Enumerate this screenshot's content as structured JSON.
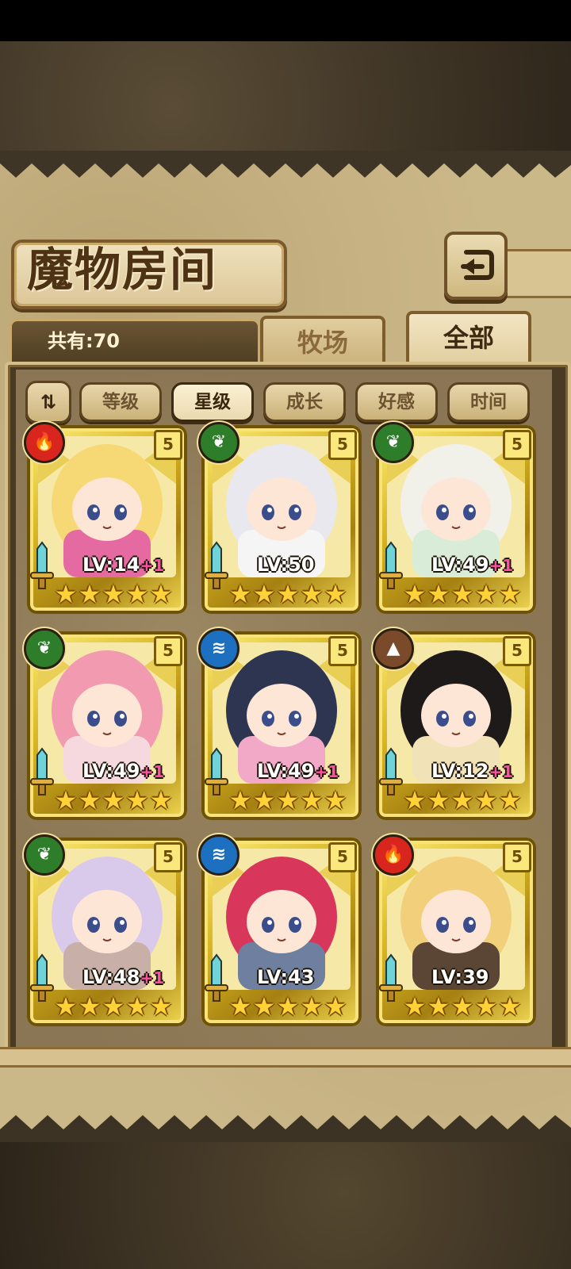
{
  "header": {
    "title": "魔物房间"
  },
  "tabs": [
    {
      "label": "牧场",
      "active": false
    },
    {
      "label": "全部",
      "active": true
    }
  ],
  "summary": {
    "count_label": "共有:70"
  },
  "sort": {
    "toggle_label": "⇅",
    "options": [
      {
        "label": "等级",
        "active": false
      },
      {
        "label": "星级",
        "active": true
      },
      {
        "label": "成长",
        "active": false
      },
      {
        "label": "好感",
        "active": false
      },
      {
        "label": "时间",
        "active": false
      }
    ]
  },
  "colors": {
    "fire": "#d8261f",
    "nature": "#2e7d2a",
    "water": "#1d6fbf",
    "earth": "#7b4a2a",
    "gold": "#e6c43a",
    "panel": "#cbb889"
  },
  "monsters": [
    {
      "level_text": "LV:14",
      "bonus": "+1",
      "element": "fire",
      "element_icon": "fire-icon",
      "rank": "5",
      "stars": 5,
      "hair": "#f6d874",
      "outfit": "#e56aa2"
    },
    {
      "level_text": "LV:50",
      "bonus": "",
      "element": "nature",
      "element_icon": "leaf-icon",
      "rank": "5",
      "stars": 5,
      "hair": "#e8e8ee",
      "outfit": "#f5f5f5"
    },
    {
      "level_text": "LV:49",
      "bonus": "+1",
      "element": "nature",
      "element_icon": "leaf-icon",
      "rank": "5",
      "stars": 5,
      "hair": "#f1f1ea",
      "outfit": "#d9ecd8"
    },
    {
      "level_text": "LV:49",
      "bonus": "+1",
      "element": "nature",
      "element_icon": "leaf-icon",
      "rank": "5",
      "stars": 5,
      "hair": "#f29ab0",
      "outfit": "#f5d9de"
    },
    {
      "level_text": "LV:49",
      "bonus": "+1",
      "element": "water",
      "element_icon": "water-icon",
      "rank": "5",
      "stars": 5,
      "hair": "#2d3550",
      "outfit": "#f2a9c8"
    },
    {
      "level_text": "LV:12",
      "bonus": "+1",
      "element": "earth",
      "element_icon": "mountain-icon",
      "rank": "5",
      "stars": 5,
      "hair": "#1e1a1a",
      "outfit": "#f1e2b8"
    },
    {
      "level_text": "LV:48",
      "bonus": "+1",
      "element": "nature",
      "element_icon": "leaf-icon",
      "rank": "5",
      "stars": 5,
      "hair": "#d9c9ea",
      "outfit": "#c8b0a8"
    },
    {
      "level_text": "LV:43",
      "bonus": "",
      "element": "water",
      "element_icon": "water-icon",
      "rank": "5",
      "stars": 5,
      "hair": "#d8365b",
      "outfit": "#6e7fa0"
    },
    {
      "level_text": "LV:39",
      "bonus": "",
      "element": "fire",
      "element_icon": "fire-icon",
      "rank": "5",
      "stars": 5,
      "hair": "#f2cf7a",
      "outfit": "#5b4534"
    }
  ]
}
